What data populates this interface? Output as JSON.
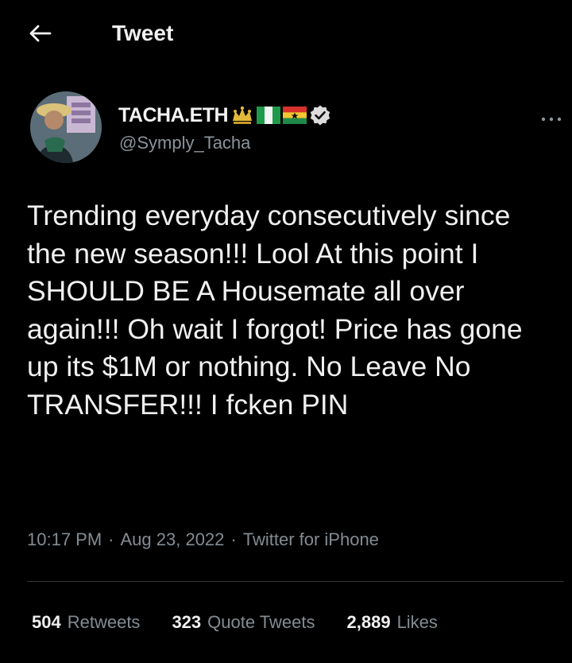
{
  "header": {
    "title": "Tweet",
    "back_icon": "arrow-left-icon"
  },
  "author": {
    "display_name": "TACHA.ETH",
    "handle": "@Symply_Tacha",
    "badges": [
      "crown-emoji",
      "nigeria-flag",
      "ghana-flag",
      "verified-icon"
    ]
  },
  "tweet": {
    "text": "Trending everyday consecutively since the new season!!! Lool At this point I SHOULD BE A Housemate all over again!!! Oh wait I forgot! Price has gone up its $1M or nothing. No Leave No TRANSFER!!! I fcken PIN",
    "time": "10:17 PM",
    "date": "Aug 23, 2022",
    "source": "Twitter for iPhone",
    "separator": "·"
  },
  "stats": {
    "retweets_count": "504",
    "retweets_label": "Retweets",
    "quotes_count": "323",
    "quotes_label": "Quote Tweets",
    "likes_count": "2,889",
    "likes_label": "Likes"
  },
  "colors": {
    "background": "#000000",
    "text": "#f0f0f0",
    "muted": "#848c92",
    "divider": "#2f3336",
    "verified": "#dcdcdc"
  }
}
